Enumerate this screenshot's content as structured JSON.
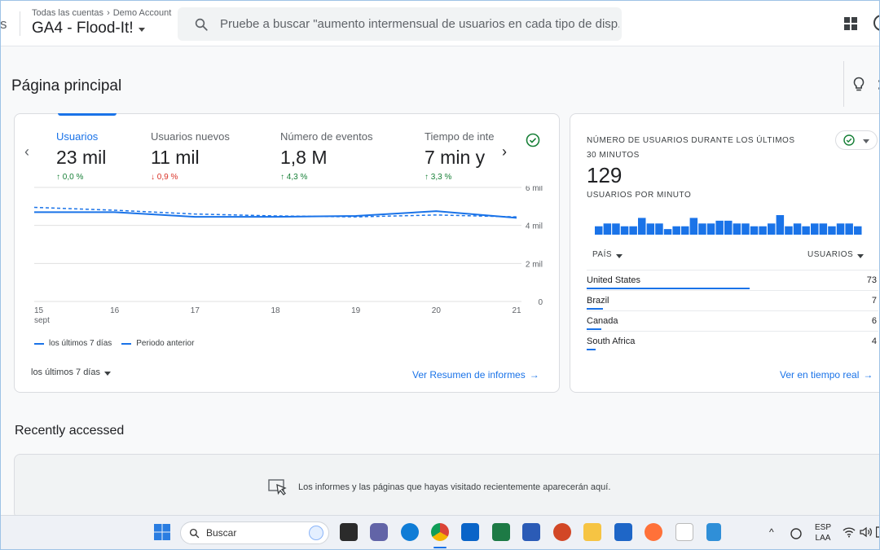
{
  "header": {
    "left_fragment": "s",
    "breadcrumb": [
      "Todas las cuentas",
      "Demo Account"
    ],
    "property": "GA4 - Flood-It!",
    "search_placeholder": "Pruebe a buscar \"aumento intermensual de usuarios en cada tipo de disp..."
  },
  "page": {
    "title": "Página principal"
  },
  "overview": {
    "metrics": [
      {
        "label": "Usuarios",
        "value": "23 mil",
        "delta": "0,0 %",
        "direction": "up"
      },
      {
        "label": "Usuarios nuevos",
        "value": "11 mil",
        "delta": "0,9 %",
        "direction": "down"
      },
      {
        "label": "Número de eventos",
        "value": "1,8 M",
        "delta": "4,3 %",
        "direction": "up"
      },
      {
        "label": "Tiempo de inter",
        "value": "7 min y",
        "delta": "3,3 %",
        "direction": "up"
      }
    ],
    "legend_current": "los últimos 7 días",
    "legend_previous": "Periodo anterior",
    "range_label": "los últimos 7 días",
    "report_link": "Ver Resumen de informes"
  },
  "chart_data": {
    "type": "line",
    "x": [
      "15",
      "16",
      "17",
      "18",
      "19",
      "20",
      "21"
    ],
    "x_sublabel": "sept",
    "y_ticks": [
      "0",
      "2 mil",
      "4 mil",
      "6 mil"
    ],
    "ylim": [
      0,
      6000
    ],
    "series": [
      {
        "name": "los últimos 7 días",
        "style": "solid",
        "values": [
          4700,
          4700,
          4450,
          4450,
          4500,
          4750,
          4400
        ]
      },
      {
        "name": "Periodo anterior",
        "style": "dashed",
        "values": [
          4950,
          4800,
          4600,
          4500,
          4450,
          4550,
          4450
        ]
      }
    ],
    "color": "#1a73e8"
  },
  "realtime": {
    "title_line1": "NÚMERO DE USUARIOS DURANTE LOS ÚLTIMOS",
    "title_line2": "30 MINUTOS",
    "value": "129",
    "subtitle": "USUARIOS POR MINUTO",
    "per_minute": [
      3,
      4,
      4,
      3,
      3,
      6,
      4,
      4,
      2,
      3,
      3,
      6,
      4,
      4,
      5,
      5,
      4,
      4,
      3,
      3,
      4,
      7,
      3,
      4,
      3,
      4,
      4,
      3,
      4,
      4,
      3
    ],
    "col_country": "PAÍS",
    "col_users": "USUARIOS",
    "rows": [
      {
        "country": "United States",
        "users": "73",
        "share": 0.56
      },
      {
        "country": "Brazil",
        "users": "7",
        "share": 0.055
      },
      {
        "country": "Canada",
        "users": "6",
        "share": 0.05
      },
      {
        "country": "South Africa",
        "users": "4",
        "share": 0.03
      }
    ],
    "link": "Ver en tiempo real"
  },
  "recent": {
    "title": "Recently accessed",
    "empty_message": "Los informes y las páginas que hayas visitado recientemente aparecerán aquí."
  },
  "taskbar": {
    "search_label": "Buscar",
    "lang_top": "ESP",
    "lang_bottom": "LAA"
  },
  "colors": {
    "accent": "#1a73e8",
    "up": "#188038",
    "down": "#d93025"
  }
}
